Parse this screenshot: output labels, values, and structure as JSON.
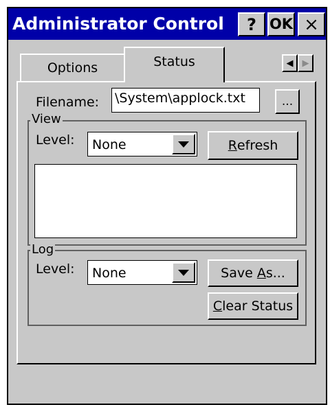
{
  "window": {
    "title": "Administrator Control",
    "help_label": "?",
    "ok_label": "OK",
    "close_label": "×"
  },
  "tabs": [
    {
      "label": "Options",
      "active": false
    },
    {
      "label": "Status",
      "active": true
    }
  ],
  "tab_scroll": {
    "left_glyph": "◀",
    "right_glyph": "▶"
  },
  "filename": {
    "label": "Filename:",
    "value": "\\System\\applock.txt",
    "browse_label": "..."
  },
  "view": {
    "group_label": "View",
    "level_label": "Level:",
    "level_value": "None",
    "refresh_label": "Refresh",
    "refresh_mnemonic": "R",
    "refresh_rest": "efresh"
  },
  "log": {
    "group_label": "Log",
    "level_label": "Level:",
    "level_value": "None",
    "save_as_label": "Save As...",
    "save_as_pre": "Save ",
    "save_as_mnemonic": "A",
    "save_as_post": "s...",
    "clear_status_label": "Clear Status",
    "clear_status_mnemonic": "C",
    "clear_status_rest": "lear Status"
  }
}
